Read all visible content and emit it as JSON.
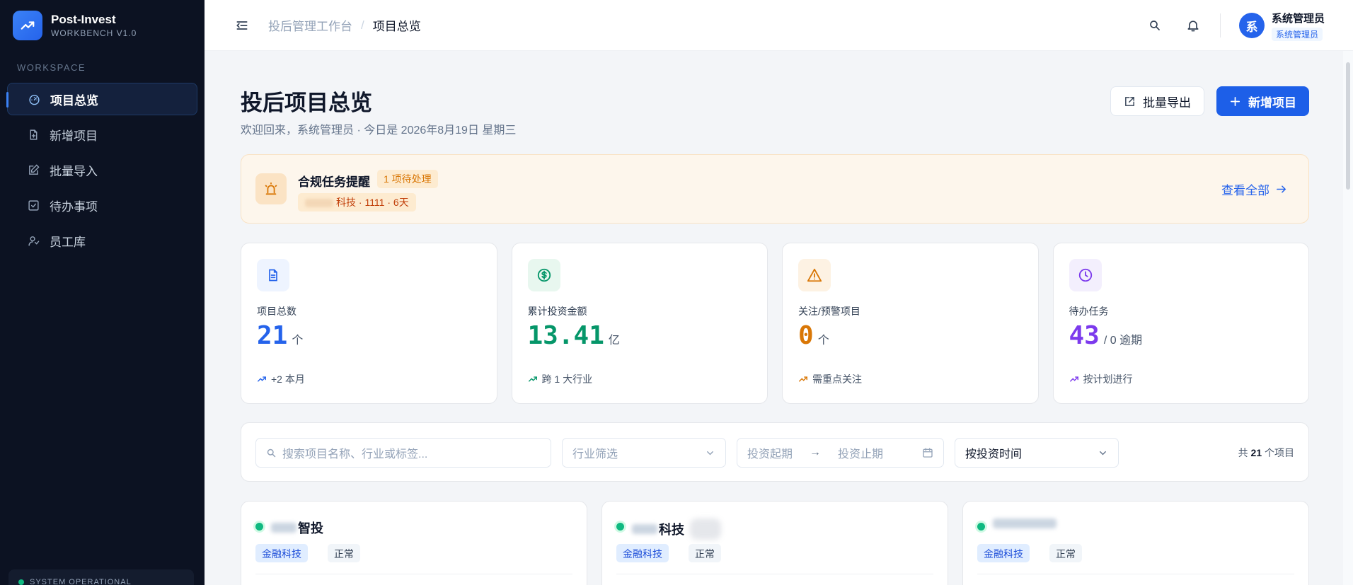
{
  "brand": {
    "title": "Post-Invest",
    "subtitle": "WORKBENCH V1.0"
  },
  "sidebar": {
    "section_label": "WORKSPACE",
    "items": [
      {
        "label": "项目总览",
        "icon": "dashboard-icon",
        "active": true
      },
      {
        "label": "新增项目",
        "icon": "file-plus-icon"
      },
      {
        "label": "批量导入",
        "icon": "edit-square-icon"
      },
      {
        "label": "待办事项",
        "icon": "checkbox-icon"
      },
      {
        "label": "员工库",
        "icon": "users-icon"
      }
    ],
    "status": "SYSTEM OPERATIONAL"
  },
  "header": {
    "breadcrumb": [
      "投后管理工作台",
      "项目总览"
    ],
    "user": {
      "avatar": "系",
      "name": "系统管理员",
      "role": "系统管理员"
    }
  },
  "page": {
    "title": "投后项目总览",
    "subtitle": "欢迎回来，系统管理员 · 今日是 2026年8月19日 星期三",
    "export_label": "批量导出",
    "add_label": "新增项目"
  },
  "alert": {
    "title": "合规任务提醒",
    "badge": "1 项待处理",
    "detail": "科技 · 1111 · 6天",
    "link": "查看全部"
  },
  "stats": [
    {
      "label": "项目总数",
      "value": "21",
      "unit": "个",
      "foot": "+2 本月",
      "color": "#2563eb",
      "icon": "document-icon",
      "bg": "#eef4ff"
    },
    {
      "label": "累计投资金额",
      "value": "13.41",
      "unit": "亿",
      "foot": "跨 1 大行业",
      "color": "#059669",
      "icon": "dollar-icon",
      "bg": "#e8f7ef"
    },
    {
      "label": "关注/预警项目",
      "value": "0",
      "unit": "个",
      "foot": "需重点关注",
      "color": "#d97706",
      "icon": "warning-icon",
      "bg": "#fdf2e3"
    },
    {
      "label": "待办任务",
      "value": "43",
      "unit": "/ 0 逾期",
      "foot": "按计划进行",
      "color": "#7c3aed",
      "icon": "clock-icon",
      "bg": "#f3effd"
    }
  ],
  "filter": {
    "search_placeholder": "搜索项目名称、行业或标签...",
    "industry_placeholder": "行业筛选",
    "date_start": "投资起期",
    "date_end": "投资止期",
    "sort_value": "按投资时间",
    "total_prefix": "共",
    "total_count": "21",
    "total_suffix": "个项目"
  },
  "projects": [
    {
      "name": "智投",
      "industry": "金融科技",
      "status": "正常"
    },
    {
      "name": "科技",
      "industry": "金融科技",
      "status": "正常"
    },
    {
      "name": "",
      "industry": "金融科技",
      "status": "正常"
    }
  ]
}
